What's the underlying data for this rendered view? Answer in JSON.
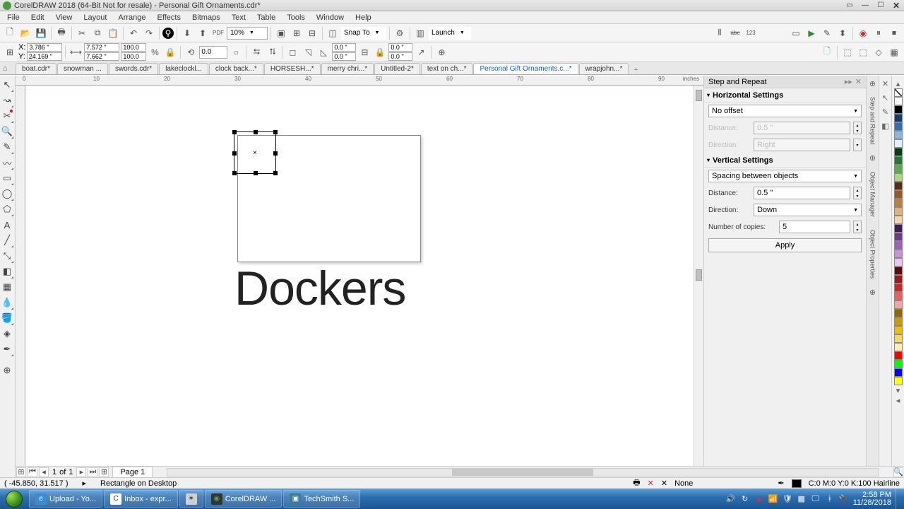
{
  "title": "CorelDRAW 2018 (64-Bit Not for resale) - Personal Gift Ornaments.cdr*",
  "menu": [
    "File",
    "Edit",
    "View",
    "Layout",
    "Arrange",
    "Effects",
    "Bitmaps",
    "Text",
    "Table",
    "Tools",
    "Window",
    "Help"
  ],
  "toolbar1": {
    "zoom": "10%",
    "snap": "Snap To",
    "launch": "Launch"
  },
  "propbar": {
    "x": "3.786 \"",
    "y": "24.169 \"",
    "w": "7.572 \"",
    "h": "7.662 \"",
    "sx": "100.0",
    "sy": "100.0",
    "rot": "0.0",
    "corner1": "0.0 \"",
    "corner2": "0.0 \"",
    "corner3": "0.0 \"",
    "corner4": "0.0 \""
  },
  "doc_tabs": [
    {
      "label": "boat.cdr*",
      "active": false
    },
    {
      "label": "snowman ...",
      "active": false
    },
    {
      "label": "swords.cdr*",
      "active": false
    },
    {
      "label": "lakeclockl...",
      "active": false
    },
    {
      "label": "clock back...*",
      "active": false
    },
    {
      "label": "HORSESH...*",
      "active": false
    },
    {
      "label": "merry chri...*",
      "active": false
    },
    {
      "label": "Untitled-2*",
      "active": false
    },
    {
      "label": "text on ch...*",
      "active": false
    },
    {
      "label": "Personal Gift Ornaments.c...*",
      "active": true
    },
    {
      "label": "wrapjohn...*",
      "active": false
    }
  ],
  "ruler_unit": "inches",
  "ruler_ticks_h": [
    "0",
    "10",
    "20",
    "30",
    "40",
    "50",
    "60",
    "70",
    "80",
    "90"
  ],
  "canvas": {
    "big_text": "Dockers"
  },
  "docker": {
    "title": "Step and Repeat",
    "horiz_header": "Horizontal Settings",
    "horiz_mode": "No offset",
    "h_distance_label": "Distance:",
    "h_distance_value": "0.5 \"",
    "h_direction_label": "Direction:",
    "h_direction_value": "Right",
    "vert_header": "Vertical Settings",
    "vert_mode": "Spacing between objects",
    "v_distance_label": "Distance:",
    "v_distance_value": "0.5 \"",
    "v_direction_label": "Direction:",
    "v_direction_value": "Down",
    "copies_label": "Number of copies:",
    "copies_value": "5",
    "apply": "Apply"
  },
  "vtabs": [
    "Step and Repeat",
    "Object Manager",
    "Object Properties"
  ],
  "palette": [
    "#ffffff",
    "#000000",
    "#1a3a66",
    "#2e6fb8",
    "#87b8e3",
    "#dff1fb",
    "#083a1c",
    "#1f7a33",
    "#54b04a",
    "#a3db7f",
    "#5e2a0f",
    "#9a5a25",
    "#c07e3c",
    "#e0b274",
    "#f2d9a8",
    "#3d1e4f",
    "#6b3a88",
    "#9a62b7",
    "#c493d8",
    "#e6c8ef",
    "#5a0c0c",
    "#9a1818",
    "#d12626",
    "#ef5e5e",
    "#f7a3a3",
    "#8f6900",
    "#c99a00",
    "#f0be00",
    "#f7d85a",
    "#fcefb0",
    "#ff0000",
    "#00ff00",
    "#0000ff",
    "#ffff00",
    "#ff00ff",
    "#00ffff"
  ],
  "page_nav": {
    "page_of": "1",
    "of_label": "of",
    "total": "1",
    "page_tab": "Page 1"
  },
  "status": {
    "coords": "( -45.850, 31.517 )",
    "object": "Rectangle on Desktop",
    "fill": "None",
    "color_info": "C:0 M:0 Y:0 K:100  Hairline"
  },
  "taskbar": {
    "items": [
      {
        "label": "Upload - Yo...",
        "icon": "e"
      },
      {
        "label": "Inbox - expr...",
        "icon": "C"
      },
      {
        "label": "",
        "icon": "✶"
      },
      {
        "label": "CorelDRAW ...",
        "icon": "◉"
      },
      {
        "label": "TechSmith S...",
        "icon": "▣"
      }
    ],
    "time": "2:58 PM",
    "date": "11/28/2018"
  }
}
